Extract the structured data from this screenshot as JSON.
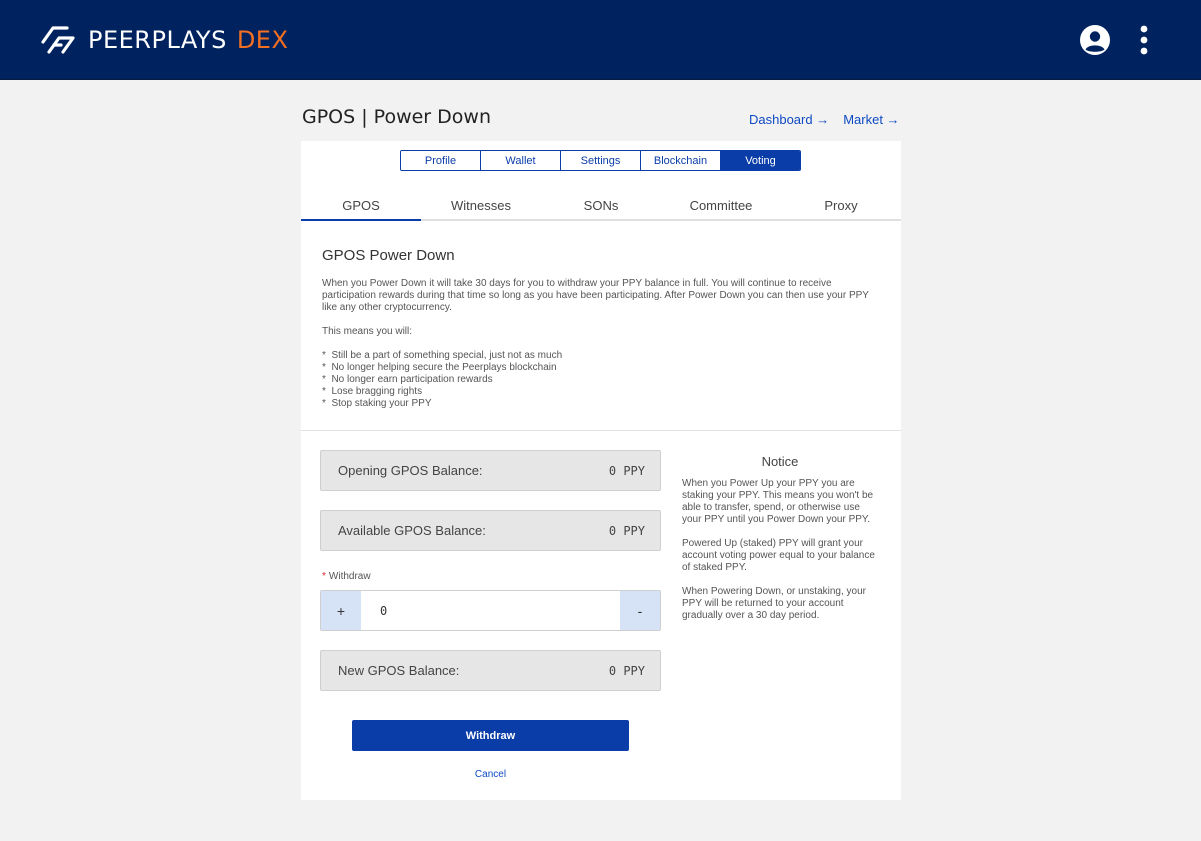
{
  "header": {
    "brand": "PEERPLAYS",
    "brand_suffix": "DEX",
    "accent_color": "#f36f21",
    "bar_color": "#00235f",
    "icons": [
      "peerplays-logo-icon",
      "user-account-icon",
      "kebab-menu-icon"
    ]
  },
  "page": {
    "title": "GPOS | Power Down",
    "links": [
      {
        "label": "Dashboard →"
      },
      {
        "label": "Market →"
      }
    ]
  },
  "segments": [
    {
      "label": "Profile",
      "active": false
    },
    {
      "label": "Wallet",
      "active": false
    },
    {
      "label": "Settings",
      "active": false
    },
    {
      "label": "Blockchain",
      "active": false
    },
    {
      "label": "Voting",
      "active": true
    }
  ],
  "tabs": [
    {
      "label": "GPOS",
      "active": true
    },
    {
      "label": "Witnesses",
      "active": false
    },
    {
      "label": "SONs",
      "active": false
    },
    {
      "label": "Committee",
      "active": false
    },
    {
      "label": "Proxy",
      "active": false
    }
  ],
  "section": {
    "title": "GPOS Power Down",
    "intro": "When you Power Down it will take 30 days for you to withdraw your PPY balance in full. You will continue to receive participation rewards during that time so long as you have been participating. After Power Down you can then use your PPY like any other cryptocurrency.",
    "means": "This means you will:",
    "bullets": [
      "Still be a part of something special, just not as much",
      "No longer helping secure the Peerplays blockchain",
      "No longer earn participation rewards",
      "Lose bragging rights",
      "Stop staking your PPY"
    ]
  },
  "form": {
    "opening": {
      "label": "Opening GPOS Balance:",
      "value": "0 PPY"
    },
    "available": {
      "label": "Available GPOS Balance:",
      "value": "0 PPY"
    },
    "withdraw": {
      "required_mark": "*",
      "label": "Withdraw",
      "value": "0",
      "plus": "+",
      "minus": "-"
    },
    "new_balance": {
      "label": "New GPOS Balance:",
      "value": "0 PPY"
    },
    "submit_label": "Withdraw",
    "cancel_label": "Cancel"
  },
  "notice": {
    "title": "Notice",
    "paragraphs": [
      "When you Power Up your PPY you are staking your PPY. This means you won't be able to transfer, spend, or otherwise use your PPY until you Power Down your PPY.",
      "Powered Up (staked) PPY will grant your account voting power equal to your balance of staked PPY.",
      "When Powering Down, or unstaking, your PPY will be returned to your account gradually over a 30 day period."
    ]
  }
}
